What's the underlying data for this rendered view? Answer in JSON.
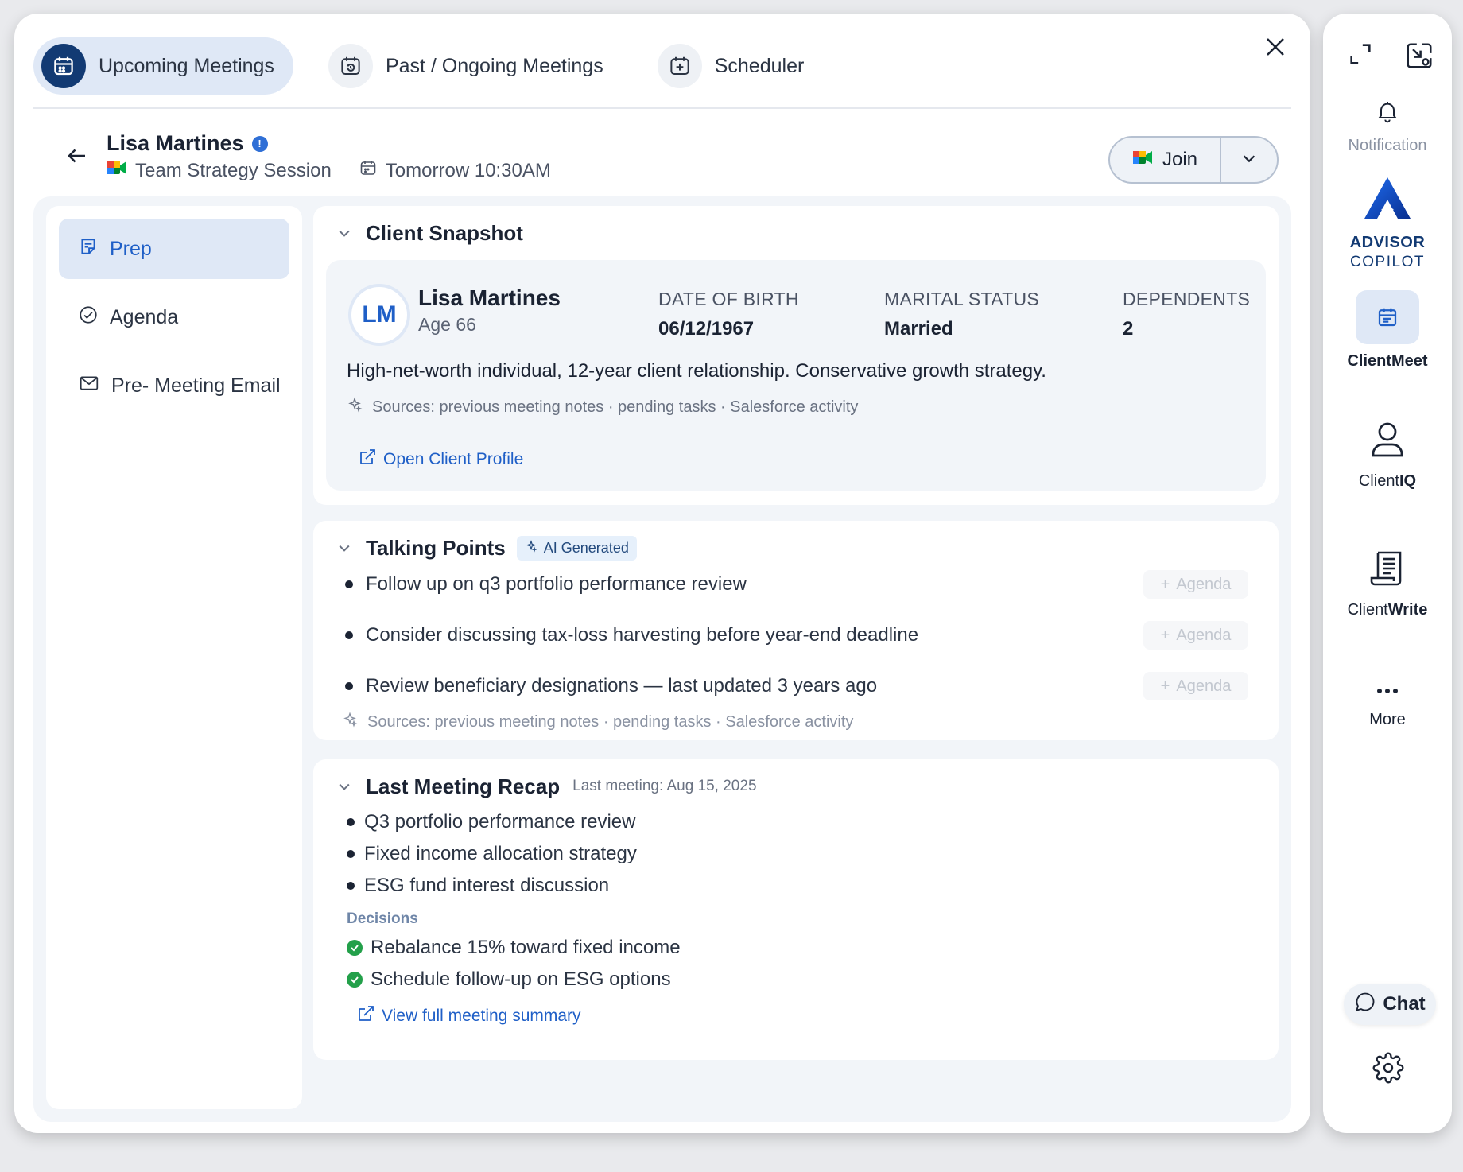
{
  "tabs": [
    {
      "label": "Upcoming Meetings",
      "icon": "calendar-icon",
      "active": true
    },
    {
      "label": "Past / Ongoing Meetings",
      "icon": "history-icon",
      "active": false
    },
    {
      "label": "Scheduler",
      "icon": "add-event-icon",
      "active": false
    }
  ],
  "meeting": {
    "client_name": "Lisa Martines",
    "meeting_title": "Team Strategy Session",
    "time": "Tomorrow 10:30AM",
    "join_label": "Join"
  },
  "left_nav": [
    {
      "label": "Prep",
      "icon": "notes-icon",
      "active": true
    },
    {
      "label": "Agenda",
      "icon": "check-circle-icon",
      "active": false
    },
    {
      "label": "Pre- Meeting Email",
      "icon": "mail-icon",
      "active": false
    }
  ],
  "snapshot": {
    "title": "Client Snapshot",
    "initials": "LM",
    "name": "Lisa Martines",
    "age": "Age 66",
    "fields": [
      {
        "label": "DATE OF BIRTH",
        "value": "06/12/1967"
      },
      {
        "label": "MARITAL STATUS",
        "value": "Married"
      },
      {
        "label": "DEPENDENTS",
        "value": "2"
      }
    ],
    "description": "High-net-worth individual, 12-year client relationship. Conservative growth strategy.",
    "sources": "Sources: previous meeting notes · pending tasks · Salesforce activity",
    "link": "Open Client Profile"
  },
  "talking_points": {
    "title": "Talking Points",
    "badge": "AI Generated",
    "items": [
      "Follow up on q3 portfolio performance review",
      "Consider discussing tax-loss harvesting before year-end deadline",
      "Review beneficiary designations — last updated 3 years ago"
    ],
    "agenda_label": "Agenda",
    "sources": "Sources: previous meeting notes · pending tasks · Salesforce activity"
  },
  "recap": {
    "title": "Last Meeting Recap",
    "subtitle": "Last meeting: Aug 15, 2025",
    "items": [
      "Q3 portfolio performance review",
      "Fixed income allocation strategy",
      "ESG fund interest discussion"
    ],
    "decisions_label": "Decisions",
    "decisions": [
      "Rebalance 15% toward fixed income",
      "Schedule follow-up on ESG options"
    ],
    "link": "View full meeting summary"
  },
  "sidebar": {
    "notification": "Notification",
    "brand_line1": "ADVISOR",
    "brand_line2": "COPILOT",
    "client_meet": "ClientMeet",
    "client_iq_prefix": "Client",
    "client_iq_suffix": "IQ",
    "client_write_prefix": "Client",
    "client_write_suffix": "Write",
    "more": "More",
    "chat": "Chat"
  },
  "colors": {
    "accent": "#1f5fc7",
    "navy": "#123a73",
    "active_bg": "#dfe8f6",
    "success": "#23a04a"
  }
}
